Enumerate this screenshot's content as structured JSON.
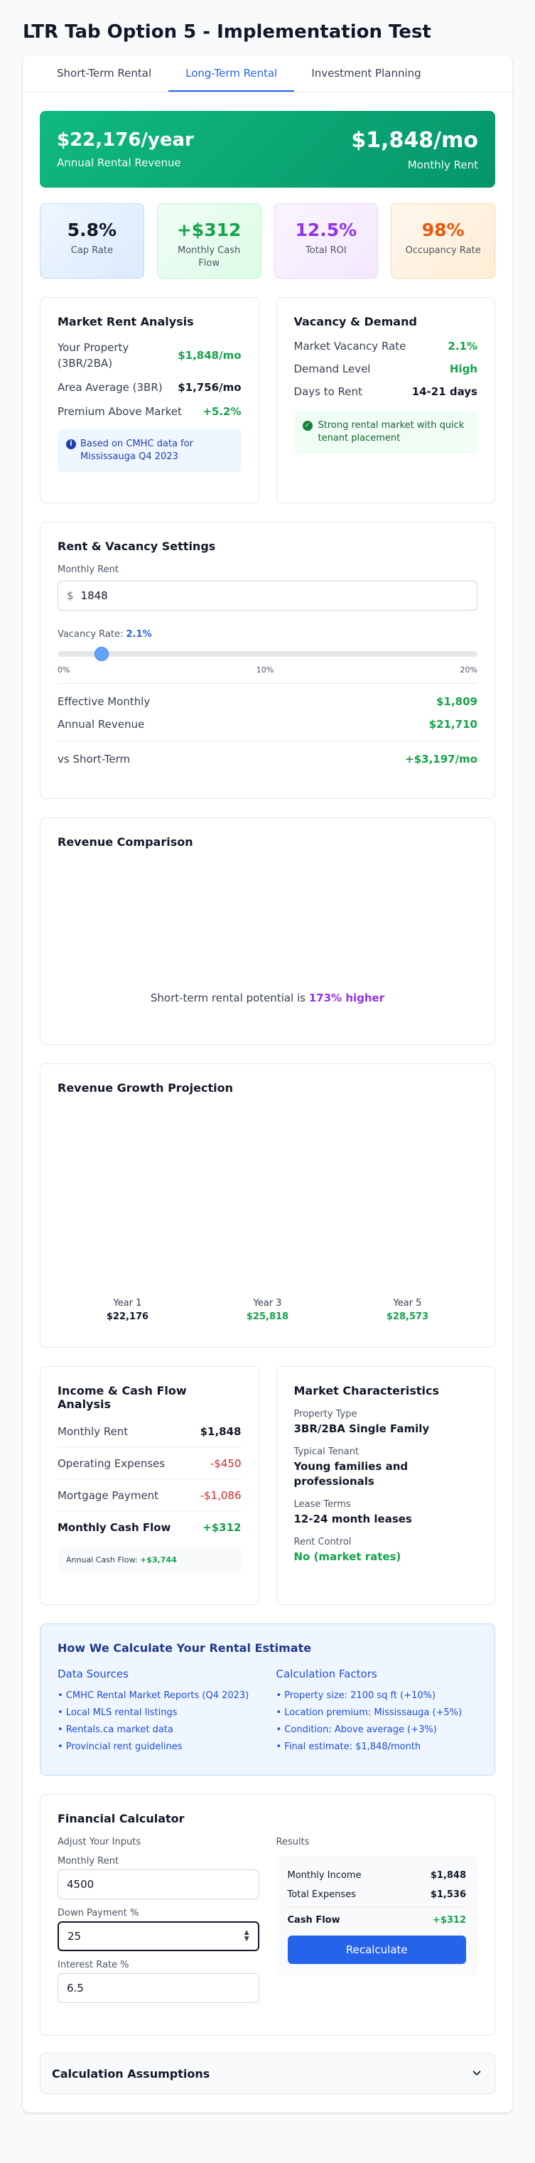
{
  "page": {
    "title": "LTR Tab Option 5 - Implementation Test"
  },
  "tabs": [
    {
      "label": "Short-Term Rental"
    },
    {
      "label": "Long-Term Rental"
    },
    {
      "label": "Investment Planning"
    }
  ],
  "banner": {
    "annual_value": "$22,176/year",
    "annual_label": "Annual Rental Revenue",
    "monthly_value": "$1,848/mo",
    "monthly_label": "Monthly Rent"
  },
  "stats": [
    {
      "value": "5.8%",
      "label": "Cap Rate"
    },
    {
      "value": "+$312",
      "label": "Monthly Cash Flow"
    },
    {
      "value": "12.5%",
      "label": "Total ROI"
    },
    {
      "value": "98%",
      "label": "Occupancy Rate"
    }
  ],
  "market_rent": {
    "title": "Market Rent Analysis",
    "rows": [
      {
        "label": "Your Property (3BR/2BA)",
        "value": "$1,848/mo"
      },
      {
        "label": "Area Average (3BR)",
        "value": "$1,756/mo"
      },
      {
        "label": "Premium Above Market",
        "value": "+5.2%"
      }
    ],
    "note": "Based on CMHC data for Mississauga Q4 2023"
  },
  "vacancy": {
    "title": "Vacancy & Demand",
    "rows": [
      {
        "label": "Market Vacancy Rate",
        "value": "2.1%"
      },
      {
        "label": "Demand Level",
        "value": "High"
      },
      {
        "label": "Days to Rent",
        "value": "14-21 days"
      }
    ],
    "note": "Strong rental market with quick tenant placement"
  },
  "settings": {
    "title": "Rent & Vacancy Settings",
    "monthly_rent_label": "Monthly Rent",
    "currency": "$",
    "monthly_rent_value": "1848",
    "vacancy_label": "Vacancy Rate:",
    "vacancy_value": "2.1%",
    "vacancy_fraction": 0.105,
    "ticks": [
      "0%",
      "10%",
      "20%"
    ],
    "results": [
      {
        "label": "Effective Monthly",
        "value": "$1,809"
      },
      {
        "label": "Annual Revenue",
        "value": "$21,710"
      }
    ],
    "vs_label": "vs Short-Term",
    "vs_value": "+$3,197/mo"
  },
  "revenue_comparison": {
    "title": "Revenue Comparison",
    "text_pre": "Short-term rental potential is ",
    "text_highlight": "173% higher"
  },
  "growth": {
    "title": "Revenue Growth Projection",
    "items": [
      {
        "label": "Year 1",
        "value": "$22,176"
      },
      {
        "label": "Year 3",
        "value": "$25,818"
      },
      {
        "label": "Year 5",
        "value": "$28,573"
      }
    ]
  },
  "income": {
    "title": "Income & Cash Flow Analysis",
    "rows": [
      {
        "label": "Monthly Rent",
        "value": "$1,848"
      },
      {
        "label": "Operating Expenses",
        "value": "-$450"
      },
      {
        "label": "Mortgage Payment",
        "value": "-$1,086"
      },
      {
        "label": "Monthly Cash Flow",
        "value": "+$312"
      }
    ],
    "annual_label": "Annual Cash Flow:",
    "annual_value": "+$3,744"
  },
  "characteristics": {
    "title": "Market Characteristics",
    "items": [
      {
        "label": "Property Type",
        "value": "3BR/2BA Single Family"
      },
      {
        "label": "Typical Tenant",
        "value": "Young families and professionals"
      },
      {
        "label": "Lease Terms",
        "value": "12-24 month leases"
      },
      {
        "label": "Rent Control",
        "value": "No (market rates)"
      }
    ]
  },
  "methodology": {
    "title": "How We Calculate Your Rental Estimate",
    "sources_title": "Data Sources",
    "sources": [
      "• CMHC Rental Market Reports (Q4 2023)",
      "• Local MLS rental listings",
      "• Rentals.ca market data",
      "• Provincial rent guidelines"
    ],
    "factors_title": "Calculation Factors",
    "factors": [
      "• Property size: 2100 sq ft (+10%)",
      "• Location premium: Mississauga (+5%)",
      "• Condition: Above average (+3%)",
      "• Final estimate: $1,848/month"
    ]
  },
  "calculator": {
    "title": "Financial Calculator",
    "inputs_title": "Adjust Your Inputs",
    "monthly_rent_label": "Monthly Rent",
    "monthly_rent_value": "4500",
    "down_payment_label": "Down Payment %",
    "down_payment_value": "25",
    "interest_label": "Interest Rate %",
    "interest_value": "6.5",
    "results_title": "Results",
    "results": [
      {
        "label": "Monthly Income",
        "value": "$1,848"
      },
      {
        "label": "Total Expenses",
        "value": "$1,536"
      },
      {
        "label": "Cash Flow",
        "value": "+$312"
      }
    ],
    "button": "Recalculate"
  },
  "assumptions": {
    "title": "Calculation Assumptions"
  },
  "colors": {
    "accent": "#2563eb",
    "green": "#16a34a",
    "red": "#dc2626",
    "purple": "#9333ea",
    "orange": "#ea580c"
  }
}
